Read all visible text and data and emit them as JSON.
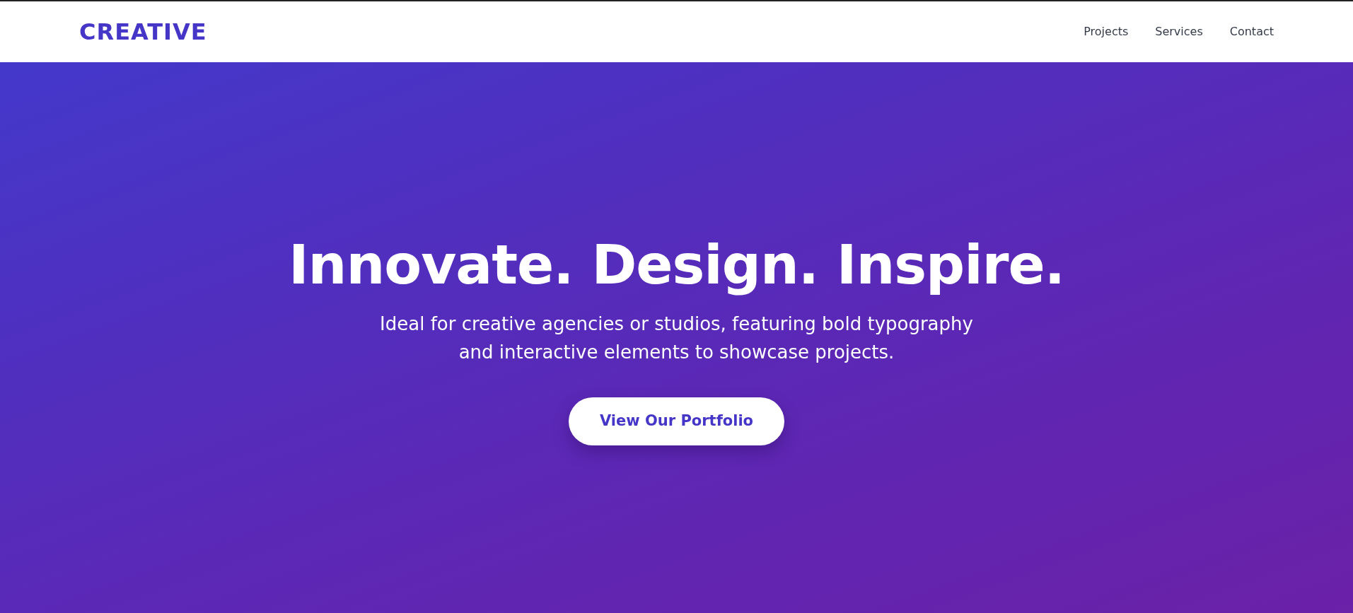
{
  "brand": {
    "text": "CREATIVE"
  },
  "nav": [
    {
      "label": "Projects"
    },
    {
      "label": "Services"
    },
    {
      "label": "Contact"
    }
  ],
  "hero": {
    "title": "Innovate. Design. Inspire.",
    "subtitle": "Ideal for creative agencies or studios, featuring bold typography and interactive elements to showcase projects.",
    "button": {
      "label": "View Our Portfolio"
    }
  }
}
